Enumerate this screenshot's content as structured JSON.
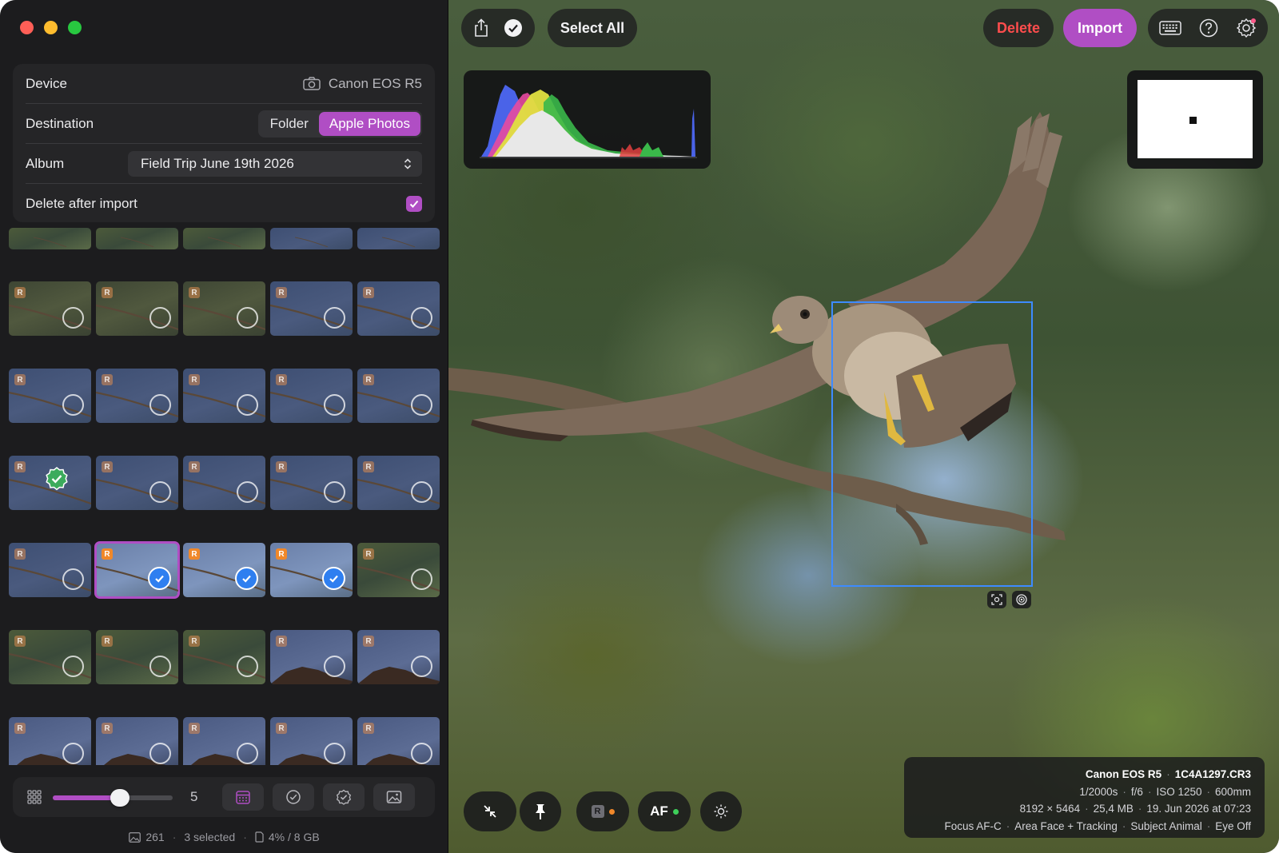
{
  "sidebar": {
    "device_label": "Device",
    "device_value": "Canon EOS R5",
    "destination_label": "Destination",
    "destination_options": [
      "Folder",
      "Apple Photos"
    ],
    "destination_selected": "Apple Photos",
    "album_label": "Album",
    "album_value": "Field Trip June 19th 2026",
    "delete_after_label": "Delete after import",
    "delete_after_checked": true,
    "thumbnail_size": "5",
    "status": {
      "count": "261",
      "selected": "3 selected",
      "storage": "4% / 8 GB"
    }
  },
  "toolbar": {
    "select_all": "Select All",
    "delete": "Delete",
    "import": "Import"
  },
  "exif": {
    "camera": "Canon EOS R5",
    "filename": "1C4A1297.CR3",
    "line2": [
      "1/2000s",
      "f/6",
      "ISO 1250",
      "600mm"
    ],
    "line3": [
      "8192 × 5464",
      "25,4 MB",
      "19. Jun 2026 at 07:23"
    ],
    "line4": [
      "Focus AF-C",
      "Area Face + Tracking",
      "Subject Animal",
      "Eye Off"
    ]
  },
  "bottom_controls": {
    "raw_badge": "R",
    "af_label": "AF"
  },
  "colors": {
    "accent": "#b04ec4",
    "delete": "#ff4d4d",
    "focus_box": "#3d8bff",
    "check_blue": "#2f7ff0"
  }
}
